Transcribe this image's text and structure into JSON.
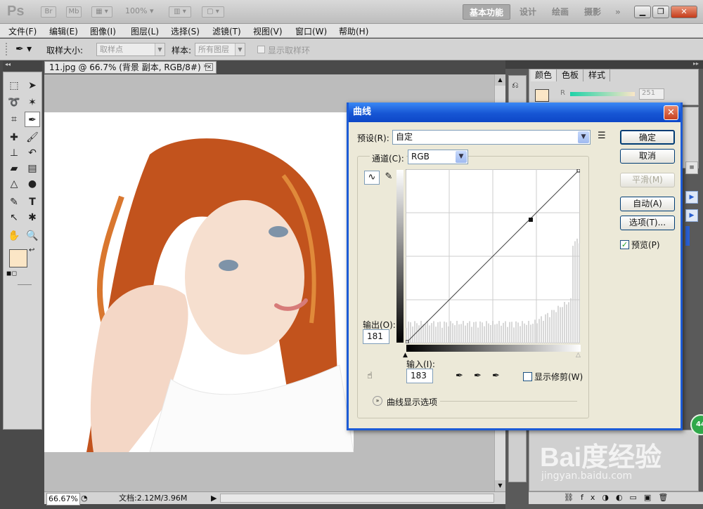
{
  "app": {
    "logo": "Ps",
    "bridge_icon": "Br",
    "minibridge_icon": "Mb",
    "zoom": "100%",
    "workspaces": [
      "基本功能",
      "设计",
      "绘画",
      "摄影"
    ],
    "more": "»"
  },
  "menu": [
    "文件(F)",
    "编辑(E)",
    "图像(I)",
    "图层(L)",
    "选择(S)",
    "滤镜(T)",
    "视图(V)",
    "窗口(W)",
    "帮助(H)"
  ],
  "options": {
    "sample_size_label": "取样大小:",
    "sample_size_value": "取样点",
    "sample_label": "样本:",
    "sample_value": "所有图层",
    "show_ring_label": "显示取样环"
  },
  "document": {
    "tab_title": "11.jpg @ 66.7% (背景 副本, RGB/8#) *",
    "status_zoom": "66.67%",
    "status_doc": "文档:2.12M/3.96M"
  },
  "color_panel": {
    "tabs": [
      "颜色",
      "色板",
      "样式"
    ],
    "r_label": "R",
    "r_value": "251",
    "colors": {
      "foreground": "#fbe6c6",
      "background": "#2f5fe0"
    }
  },
  "curves": {
    "title": "曲线",
    "preset_label": "预设(R):",
    "preset_value": "自定",
    "channel_label": "通道(C):",
    "channel_value": "RGB",
    "output_label": "输出(O):",
    "output_value": "181",
    "input_label": "输入(I):",
    "input_value": "183",
    "show_clipping_label": "显示修剪(W)",
    "display_options_label": "曲线显示选项",
    "buttons": {
      "ok": "确定",
      "cancel": "取消",
      "smooth": "平滑(M)",
      "auto": "自动(A)",
      "options": "选项(T)...",
      "preview": "预览(P)"
    },
    "preview_checked": true,
    "point": {
      "input": 183,
      "output": 181
    }
  },
  "watermark": {
    "brand": "Bai度经验",
    "url": "jingyan.baidu.com"
  }
}
